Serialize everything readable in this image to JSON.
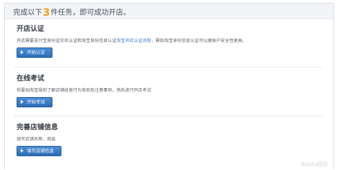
{
  "header": {
    "prefix": "完成以下",
    "count": "3",
    "suffix": "件任务，即可成功开店。"
  },
  "sections": [
    {
      "title": "开店认证",
      "desc_prefix": "开店需要支付宝身份证实名认证和淘宝身份信息认证",
      "desc_link": "淘宝开店认证流程",
      "desc_suffix": "，需如淘宝身份信息认证可以便账户安全性更高。",
      "button": "开始认证"
    },
    {
      "title": "在线考试",
      "desc_prefix": "你要如淘宝规则了解店铺经营行为准则及注意事项，然后进行开店考试",
      "desc_link": "",
      "desc_suffix": "",
      "button": "开始考试"
    },
    {
      "title": "完善店铺信息",
      "desc_prefix": "填写店铺名称、商品",
      "desc_link": "",
      "desc_suffix": "",
      "button": "填写店铺信息"
    }
  ],
  "watermark": "Baidu经验"
}
